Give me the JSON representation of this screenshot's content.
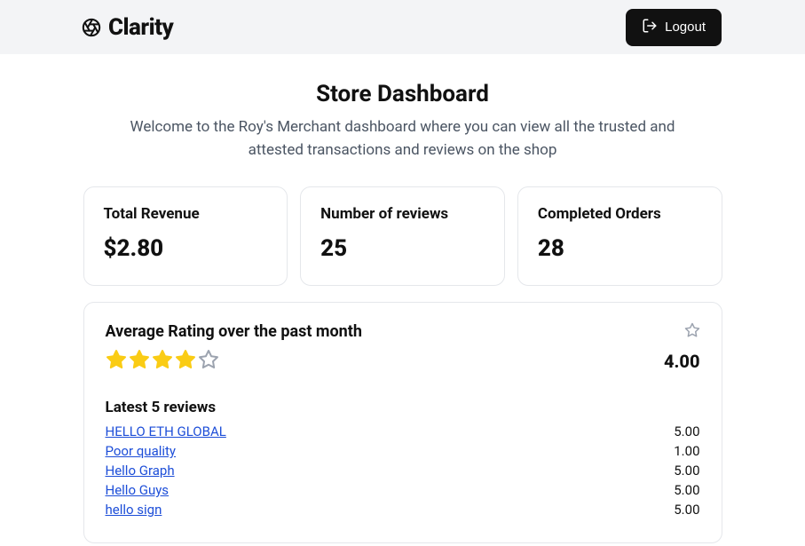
{
  "brand": {
    "name": "Clarity"
  },
  "logout": {
    "label": "Logout"
  },
  "header": {
    "title": "Store Dashboard",
    "subtitle": "Welcome to the Roy's Merchant dashboard where you can view all the trusted and attested transactions and reviews on the shop"
  },
  "stats": {
    "revenue": {
      "label": "Total Revenue",
      "value": "$2.80"
    },
    "reviews": {
      "label": "Number of reviews",
      "value": "25"
    },
    "orders": {
      "label": "Completed Orders",
      "value": "28"
    }
  },
  "ratings": {
    "title": "Average Rating over the past month",
    "stars_filled": 4,
    "stars_total": 5,
    "value": "4.00",
    "latest_title": "Latest 5 reviews",
    "reviews": [
      {
        "title": "HELLO ETH GLOBAL",
        "score": "5.00"
      },
      {
        "title": "Poor quality",
        "score": "1.00"
      },
      {
        "title": "Hello Graph",
        "score": "5.00"
      },
      {
        "title": "Hello Guys",
        "score": "5.00"
      },
      {
        "title": "hello sign",
        "score": "5.00"
      }
    ]
  },
  "colors": {
    "star": "#facc15",
    "star_empty": "#9ca3af",
    "link": "#1d4ed8"
  }
}
